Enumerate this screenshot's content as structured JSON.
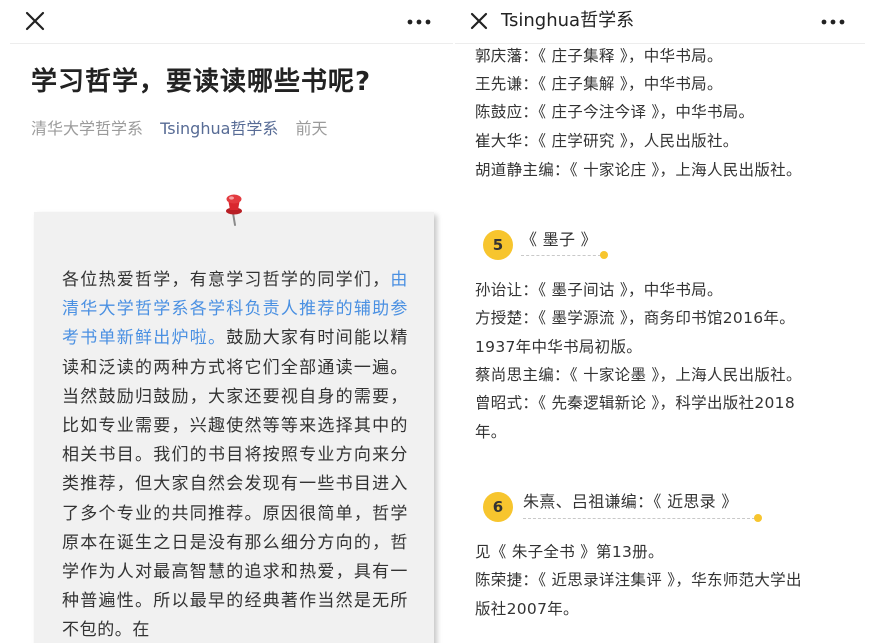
{
  "left": {
    "article_title": "学习哲学，要读读哪些书呢?",
    "author": "清华大学哲学系",
    "account": "Tsinghua哲学系",
    "time": "前天",
    "card_text_1": "各位热爱哲学，有意学习哲学的同学们，",
    "card_text_highlight": "由清华大学哲学系各学科负责人推荐的辅助参考书单新鲜出炉啦。",
    "card_text_2": "鼓励大家有时间能以精读和泛读的两种方式将它们全部通读一遍。当然鼓励归鼓励，大家还要视自身的需要，比如专业需要，兴趣使然等等来选择其中的相关书目。我们的书目将按照专业方向来分类推荐，但大家自然会发现有一些书目进入了多个专业的共同推荐。原因很简单，哲学原本在诞生之日是没有那么细分方向的，哲学作为人对最高智慧的追求和热爱，具有一种普遍性。所以最早的经典著作当然是无所不包的。在"
  },
  "right": {
    "topbar_title": "Tsinghua哲学系",
    "top_lines": [
      "郭庆藩：《 庄子集释 》，中华书局。",
      "王先谦：《 庄子集解 》，中华书局。",
      "陈鼓应：《 庄子今注今译 》，中华书局。",
      "崔大华：《 庄学研究 》，人民出版社。",
      "胡道静主编：《 十家论庄 》，上海人民出版社。"
    ],
    "sections": [
      {
        "number": "5",
        "title": "《 墨子 》",
        "lines": [
          "孙诒让：《 墨子间诂 》，中华书局。",
          "方授楚：《 墨学源流 》，商务印书馆2016年。",
          "1937年中华书局初版。",
          "蔡尚思主编：《 十家论墨 》，上海人民出版社。",
          "曾昭式：《 先秦逻辑新论 》，科学出版社2018",
          "年。"
        ]
      },
      {
        "number": "6",
        "title": "朱熹、吕祖谦编：《 近思录 》",
        "lines": [
          "见《 朱子全书 》第13册。",
          "陈荣捷：《 近思录详注集评 》，华东师范大学出",
          "版社2007年。"
        ]
      }
    ]
  },
  "icons": {
    "close": "close-icon",
    "more": "more-icon",
    "pin": "pushpin-icon"
  },
  "colors": {
    "link": "#576b95",
    "highlight": "#4a90e2",
    "accent": "#f7c52e",
    "pin": "#d9272e"
  }
}
